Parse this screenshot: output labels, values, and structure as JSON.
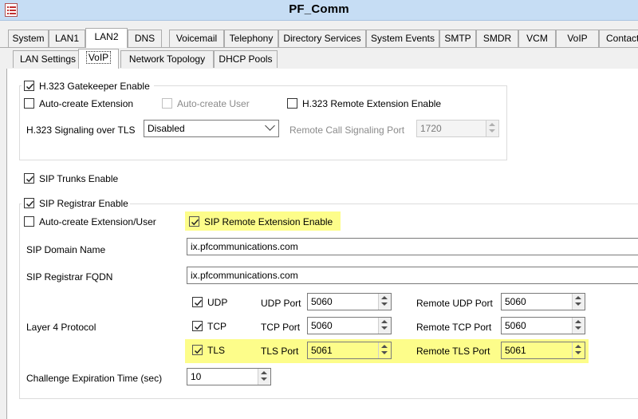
{
  "window": {
    "title": "PF_Comm",
    "menu_icon": "list-menu-icon"
  },
  "tabs_main": [
    "System",
    "LAN1",
    "LAN2",
    "DNS",
    "Voicemail",
    "Telephony",
    "Directory Services",
    "System Events",
    "SMTP",
    "SMDR",
    "VCM",
    "VoIP",
    "Contact"
  ],
  "tabs_main_selected": "LAN2",
  "tabs_sub": [
    "LAN Settings",
    "VoIP",
    "Network Topology",
    "DHCP Pools"
  ],
  "tabs_sub_selected": "VoIP",
  "h323": {
    "gatekeeper_label": "H.323 Gatekeeper Enable",
    "gatekeeper_checked": true,
    "auto_ext_label": "Auto-create Extension",
    "auto_ext_checked": false,
    "auto_user_label": "Auto-create User",
    "auto_user_checked": false,
    "remote_ext_label": "H.323 Remote Extension Enable",
    "remote_ext_checked": false,
    "tls_label": "H.323 Signaling over TLS",
    "tls_value": "Disabled",
    "remote_port_label": "Remote Call Signaling Port",
    "remote_port_value": "1720"
  },
  "sip_trunks": {
    "label": "SIP Trunks Enable",
    "checked": true
  },
  "sip_registrar": {
    "label": "SIP Registrar Enable",
    "checked": true,
    "auto_create_label": "Auto-create Extension/User",
    "auto_create_checked": false,
    "remote_ext_label": "SIP Remote Extension Enable",
    "remote_ext_checked": true,
    "domain_label": "SIP Domain Name",
    "domain_value": "ix.pfcommunications.com",
    "fqdn_label": "SIP Registrar FQDN",
    "fqdn_value": "ix.pfcommunications.com",
    "layer4_label": "Layer 4 Protocol",
    "udp_label": "UDP",
    "udp_checked": true,
    "udp_port_label": "UDP Port",
    "udp_port_value": "5060",
    "remote_udp_label": "Remote UDP Port",
    "remote_udp_value": "5060",
    "tcp_label": "TCP",
    "tcp_checked": true,
    "tcp_port_label": "TCP Port",
    "tcp_port_value": "5060",
    "remote_tcp_label": "Remote TCP Port",
    "remote_tcp_value": "5060",
    "tls_label": "TLS",
    "tls_checked": true,
    "tls_port_label": "TLS Port",
    "tls_port_value": "5061",
    "remote_tls_label": "Remote TLS Port",
    "remote_tls_value": "5061",
    "challenge_label": "Challenge Expiration Time (sec)",
    "challenge_value": "10"
  },
  "colors": {
    "highlight": "#fdfd8a",
    "titlebar": "#c6ddf4"
  }
}
